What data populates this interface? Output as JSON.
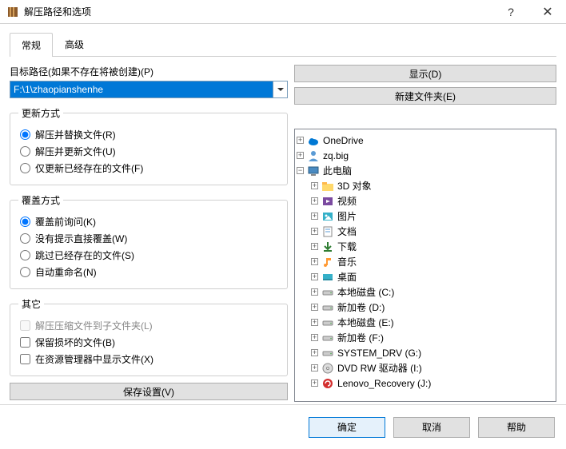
{
  "window": {
    "title": "解压路径和选项"
  },
  "tabs": {
    "general": "常规",
    "advanced": "高级"
  },
  "pathLabel": "目标路径(如果不存在将被创建)(P)",
  "pathValue": "F:\\1\\zhaopianshenhe",
  "buttons": {
    "display": "显示(D)",
    "newFolder": "新建文件夹(E)",
    "saveSettings": "保存设置(V)",
    "ok": "确定",
    "cancel": "取消",
    "help": "帮助"
  },
  "groups": {
    "update": {
      "legend": "更新方式",
      "o1": "解压并替换文件(R)",
      "o2": "解压并更新文件(U)",
      "o3": "仅更新已经存在的文件(F)"
    },
    "overwrite": {
      "legend": "覆盖方式",
      "o1": "覆盖前询问(K)",
      "o2": "没有提示直接覆盖(W)",
      "o3": "跳过已经存在的文件(S)",
      "o4": "自动重命名(N)"
    },
    "other": {
      "legend": "其它",
      "o1": "解压压缩文件到子文件夹(L)",
      "o2": "保留损坏的文件(B)",
      "o3": "在资源管理器中显示文件(X)"
    }
  },
  "tree": [
    {
      "depth": 0,
      "exp": "+",
      "icon": "cloud",
      "label": "OneDrive"
    },
    {
      "depth": 0,
      "exp": "+",
      "icon": "user",
      "label": "zq.big"
    },
    {
      "depth": 0,
      "exp": "-",
      "icon": "pc",
      "label": "此电脑"
    },
    {
      "depth": 1,
      "exp": "+",
      "icon": "folder3d",
      "label": "3D 对象"
    },
    {
      "depth": 1,
      "exp": "+",
      "icon": "video",
      "label": "视频"
    },
    {
      "depth": 1,
      "exp": "+",
      "icon": "pic",
      "label": "图片"
    },
    {
      "depth": 1,
      "exp": "+",
      "icon": "doc",
      "label": "文档"
    },
    {
      "depth": 1,
      "exp": "+",
      "icon": "dl",
      "label": "下载"
    },
    {
      "depth": 1,
      "exp": "+",
      "icon": "music",
      "label": "音乐"
    },
    {
      "depth": 1,
      "exp": "+",
      "icon": "desk",
      "label": "桌面"
    },
    {
      "depth": 1,
      "exp": "+",
      "icon": "drive",
      "label": "本地磁盘 (C:)"
    },
    {
      "depth": 1,
      "exp": "+",
      "icon": "drive",
      "label": "新加卷 (D:)"
    },
    {
      "depth": 1,
      "exp": "+",
      "icon": "drive",
      "label": "本地磁盘 (E:)"
    },
    {
      "depth": 1,
      "exp": "+",
      "icon": "drive",
      "label": "新加卷 (F:)"
    },
    {
      "depth": 1,
      "exp": "+",
      "icon": "drive",
      "label": "SYSTEM_DRV (G:)"
    },
    {
      "depth": 1,
      "exp": "+",
      "icon": "dvd",
      "label": "DVD RW 驱动器 (I:)"
    },
    {
      "depth": 1,
      "exp": "+",
      "icon": "rec",
      "label": "Lenovo_Recovery (J:)"
    }
  ]
}
